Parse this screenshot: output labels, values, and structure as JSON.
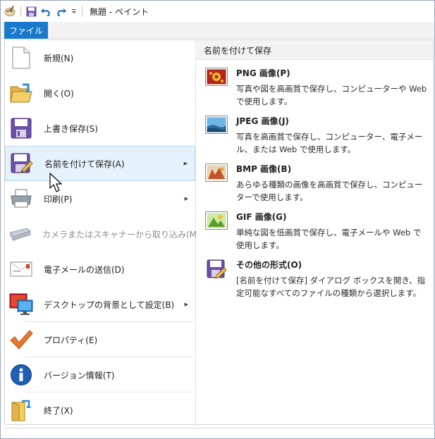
{
  "window": {
    "title": "無題 - ペイント"
  },
  "ribbon": {
    "file_tab": "ファイル"
  },
  "menu": {
    "items": [
      {
        "label": "新規(N)"
      },
      {
        "label": "開く(O)"
      },
      {
        "label": "上書き保存(S)"
      },
      {
        "label": "名前を付けて保存(A)"
      },
      {
        "label": "印刷(P)"
      },
      {
        "label": "カメラまたはスキャナーから取り込み(M)"
      },
      {
        "label": "電子メールの送信(D)"
      },
      {
        "label": "デスクトップの背景として設定(B)"
      },
      {
        "label": "プロパティ(E)"
      },
      {
        "label": "バージョン情報(T)"
      },
      {
        "label": "終了(X)"
      }
    ]
  },
  "submenu": {
    "heading": "名前を付けて保存",
    "options": [
      {
        "title": "PNG 画像(P)",
        "description": "写真や図を高画質で保存し、コンピューターや Web で使用します。"
      },
      {
        "title": "JPEG 画像(J)",
        "description": "写真を高画質で保存し、コンピューター、電子メール、または Web で使用します。"
      },
      {
        "title": "BMP 画像(B)",
        "description": "あらゆる種類の画像を高画質で保存し、コンピューターで使用します。"
      },
      {
        "title": "GIF 画像(G)",
        "description": "単純な図を低画質で保存し、電子メールや Web で使用します。"
      },
      {
        "title": "その他の形式(O)",
        "description": "[名前を付けて保存] ダイアログ ボックスを開き、指定可能なすべてのファイルの種類から選択します。"
      }
    ]
  },
  "colors": {
    "file_tab": "#1979ca",
    "selected_bg": "#e5f1fb",
    "selected_border": "#b7d7f1",
    "disabled_text": "#8d8d8d"
  }
}
